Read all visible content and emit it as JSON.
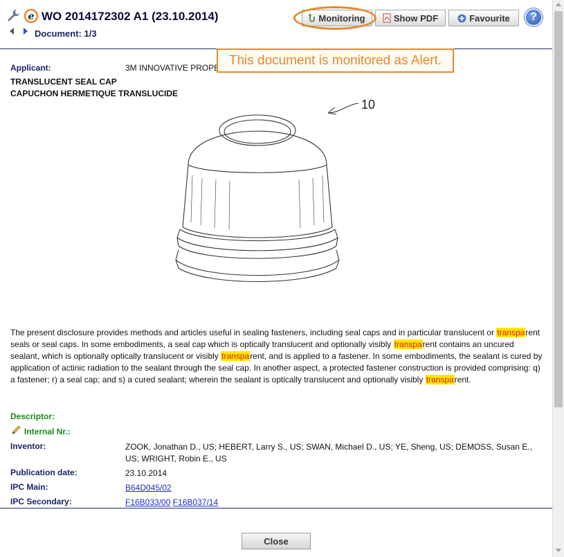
{
  "header": {
    "title": "WO 2014172302 A1 (23.10.2014)",
    "document_counter": "Document: 1/3",
    "buttons": {
      "monitoring": "Monitoring",
      "show_pdf": "Show PDF",
      "favourite": "Favourite"
    },
    "help_label": "?"
  },
  "tooltip": "This document is monitored as Alert.",
  "document": {
    "applicant_label": "Applicant:",
    "applicant_value": "3M INNOVATIVE PROPERTIES COMPANY",
    "title_en": "TRANSLUCENT SEAL CAP",
    "title_fr": "CAPUCHON HERMETIQUE TRANSLUCIDE",
    "drawing_ref": "10",
    "abstract": {
      "p1": "The present disclosure provides methods and articles useful in sealing fasteners, including seal caps and in particular translucent or ",
      "hl": "transpa",
      "p2": "rent seals or seal caps. In some embodiments, a seal cap which is optically translucent and optionally visibly ",
      "p3": "rent contains an uncured sealant, which is optionally optically translucent or visibly ",
      "p4": "rent, and is applied to a fastener. In some embodiments, the sealant is cured by application of actinic radiation to the sealant through the seal cap. In another aspect, a protected fastener construction is provided comprising: q) a fastener; r) a seal cap; and s) a cured sealant; wherein the sealant is optically translucent and optionally visibly ",
      "p5": "rent."
    },
    "descriptor_label": "Descriptor:",
    "internal_label": "Internal Nr.:",
    "inventor_label": "Inventor:",
    "inventor_value": "ZOOK, Jonathan D., US; HEBERT, Larry S., US; SWAN, Michael D., US; YE, Sheng, US; DEMOSS, Susan E., US; WRIGHT, Robin E., US",
    "pubdate_label": "Publication date:",
    "pubdate_value": "23.10.2014",
    "ipc_main_label": "IPC Main:",
    "ipc_main_value": "B64D045/02",
    "ipc_secondary_label": "IPC Secondary:",
    "ipc_secondary_values": [
      "F16B033/00",
      "F16B037/14"
    ]
  },
  "footer": {
    "close_label": "Close"
  },
  "colors": {
    "accent_orange": "#e8892a",
    "highlight_bg": "#ffe600",
    "highlight_text": "#e0191f",
    "navy": "#1a2266",
    "green": "#1a8a1a"
  }
}
